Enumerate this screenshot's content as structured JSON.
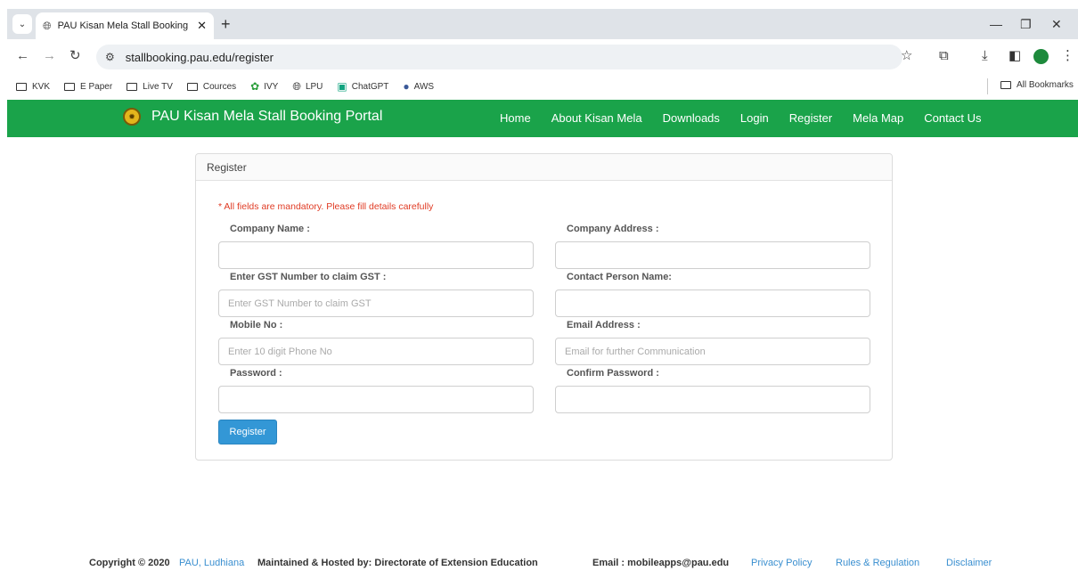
{
  "browser": {
    "tab_title": "PAU Kisan Mela Stall Booking Port",
    "tab_close": "✕",
    "new_tab": "+",
    "url": "stallbooking.pau.edu/register",
    "bookmarks": [
      {
        "label": "KVK",
        "icon": "folder-icon"
      },
      {
        "label": "E Paper",
        "icon": "folder-icon"
      },
      {
        "label": "Live TV",
        "icon": "folder-icon"
      },
      {
        "label": "Cources",
        "icon": "folder-icon"
      },
      {
        "label": "IVY",
        "icon": "ivy-icon"
      },
      {
        "label": "LPU",
        "icon": "globe-icon"
      },
      {
        "label": "ChatGPT",
        "icon": "chatgpt-icon"
      },
      {
        "label": "AWS",
        "icon": "aws-icon"
      }
    ],
    "all_bookmarks": "All Bookmarks"
  },
  "site": {
    "brand": "PAU Kisan Mela Stall Booking Portal",
    "menu": [
      "Home",
      "About Kisan Mela",
      "Downloads",
      "Login",
      "Register",
      "Mela Map",
      "Contact Us"
    ]
  },
  "form": {
    "panel_title": "Register",
    "mandatory_note": "* All fields are mandatory. Please fill details carefully",
    "company_name": {
      "label": "Company Name :",
      "value": "",
      "placeholder": ""
    },
    "company_address": {
      "label": "Company Address :",
      "value": "",
      "placeholder": ""
    },
    "gst_number": {
      "label": "Enter GST Number to claim GST :",
      "value": "",
      "placeholder": "Enter GST Number to claim GST"
    },
    "contact_person": {
      "label": "Contact Person Name:",
      "value": "",
      "placeholder": ""
    },
    "mobile": {
      "label": "Mobile No :",
      "value": "",
      "placeholder": "Enter 10 digit Phone No"
    },
    "email": {
      "label": "Email Address :",
      "value": "",
      "placeholder": "Email for further Communication"
    },
    "password": {
      "label": "Password :",
      "value": "",
      "placeholder": ""
    },
    "confirm_password": {
      "label": "Confirm Password :",
      "value": "",
      "placeholder": ""
    },
    "submit_label": "Register"
  },
  "footer": {
    "copyright": "Copyright © 2020",
    "pau_link": "PAU, Ludhiana",
    "maintained": "Maintained & Hosted by: Directorate of Extension Education",
    "email": "Email : mobileapps@pau.edu",
    "privacy": "Privacy Policy",
    "rules": "Rules & Regulation",
    "disclaimer": "Disclaimer"
  },
  "colors": {
    "nav_green": "#1aa34a",
    "button_blue": "#3397d6",
    "mandatory_red": "#e03b24",
    "link_blue": "#3a8fd0"
  }
}
